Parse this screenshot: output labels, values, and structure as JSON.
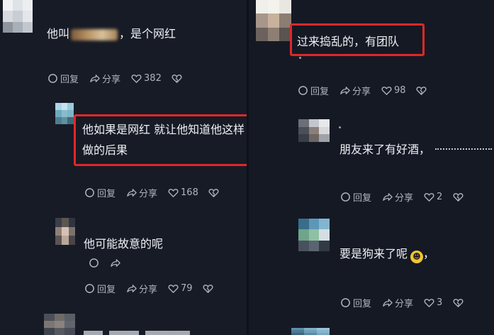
{
  "left": {
    "comments": [
      {
        "text_pre": "他叫",
        "text_post": "，是个网红",
        "reply": "回复",
        "share": "分享",
        "likes": "382"
      },
      {
        "text": "他如果是网红 就让他知道他这样做的后果",
        "reply": "回复",
        "share": "分享",
        "likes": "168"
      },
      {
        "text": "他可能故意的呢",
        "reply": "回复",
        "share": "分享",
        "likes": "79"
      },
      {
        "text": ""
      }
    ]
  },
  "right": {
    "comments": [
      {
        "text": "过来捣乱的，有团队",
        "reply": "回复",
        "share": "分享",
        "likes": "98"
      },
      {
        "text": "朋友来了有好酒，",
        "reply": "回复",
        "share": "分享",
        "likes": "2"
      },
      {
        "text": "要是狗来了呢",
        "reply": "回复",
        "share": "分享",
        "likes": "3"
      }
    ]
  },
  "icons": {
    "reply": "reply-bubble-icon",
    "share": "share-arrow-icon",
    "like": "heart-icon",
    "dislike": "broken-heart-icon",
    "emoji": "laughing-tears-emoji-icon"
  },
  "colors": {
    "background": "#161a25",
    "text": "#eef0f4",
    "action_text": "#aeb3c0",
    "highlight_box": "#e0272a"
  }
}
